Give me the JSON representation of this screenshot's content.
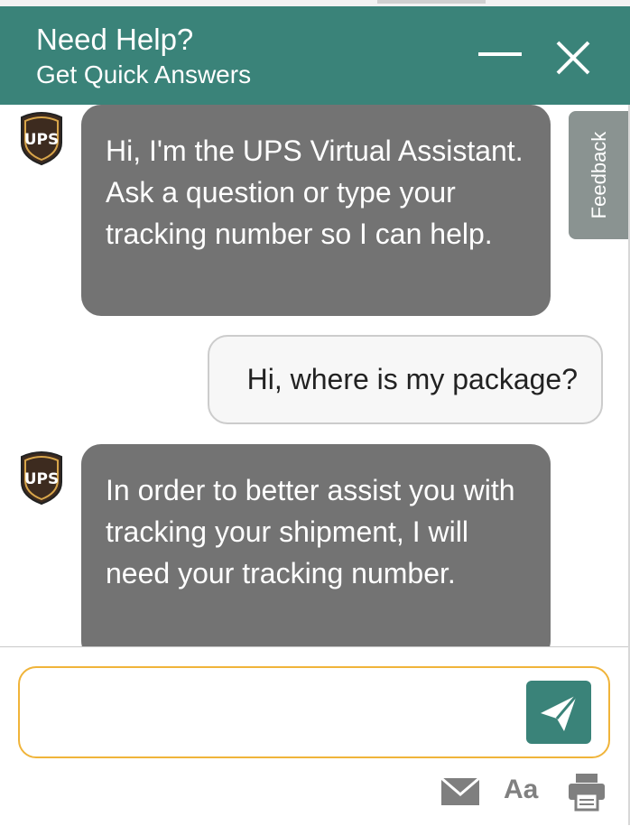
{
  "header": {
    "title": "Need Help?",
    "subtitle": "Get Quick Answers",
    "minimize_icon": "minimize-icon",
    "close_icon": "close-icon"
  },
  "feedback": {
    "label": "Feedback"
  },
  "messages": [
    {
      "sender": "bot",
      "text": "Hi, I'm the UPS Virtual Assistant. Ask a question or type your tracking number so I can help."
    },
    {
      "sender": "user",
      "text": "Hi, where is my package?"
    },
    {
      "sender": "bot",
      "text": "In order to better assist you with tracking your shipment, I will need your tracking number."
    }
  ],
  "avatar": {
    "brand_text": "UPS",
    "icon": "ups-shield-logo"
  },
  "input": {
    "value": "",
    "placeholder": ""
  },
  "toolbar": {
    "send_icon": "paper-plane-icon",
    "email_icon": "envelope-icon",
    "font_size_label": "Aa",
    "print_icon": "printer-icon"
  },
  "colors": {
    "header_bg": "#3a8379",
    "bot_bubble": "#737373",
    "user_bubble": "#f7f7f7",
    "input_border": "#f0b43a",
    "feedback_tab": "#8a9391"
  }
}
